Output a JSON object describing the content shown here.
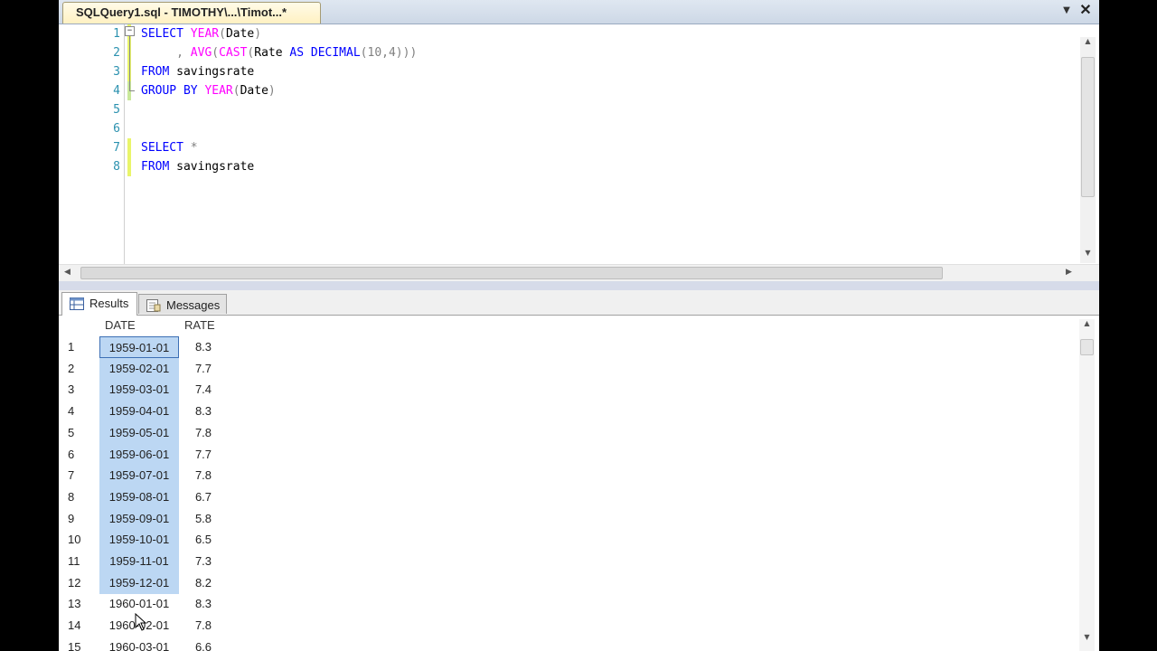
{
  "document_tab": {
    "title": "SQLQuery1.sql - TIMOTHY\\...\\Timot...*",
    "dropdown_icon": "chevron-down-icon",
    "close_icon": "close-icon"
  },
  "editor": {
    "line_numbers": [
      "1",
      "2",
      "3",
      "4",
      "5",
      "6",
      "7",
      "8"
    ],
    "lines": [
      {
        "segments": [
          {
            "t": "SELECT ",
            "c": "kw"
          },
          {
            "t": "YEAR",
            "c": "fn"
          },
          {
            "t": "(",
            "c": "op"
          },
          {
            "t": "Date",
            "c": "id"
          },
          {
            "t": ")",
            "c": "op"
          }
        ]
      },
      {
        "segments": [
          {
            "t": "     , ",
            "c": "op"
          },
          {
            "t": "AVG",
            "c": "fn"
          },
          {
            "t": "(",
            "c": "op"
          },
          {
            "t": "CAST",
            "c": "fn"
          },
          {
            "t": "(",
            "c": "op"
          },
          {
            "t": "Rate ",
            "c": "id"
          },
          {
            "t": "AS ",
            "c": "kw"
          },
          {
            "t": "DECIMAL",
            "c": "kw"
          },
          {
            "t": "(10,4)))",
            "c": "op"
          }
        ]
      },
      {
        "segments": [
          {
            "t": "FROM ",
            "c": "kw"
          },
          {
            "t": "savingsrate",
            "c": "id"
          }
        ]
      },
      {
        "segments": [
          {
            "t": "GROUP BY ",
            "c": "kw"
          },
          {
            "t": "YEAR",
            "c": "fn"
          },
          {
            "t": "(",
            "c": "op"
          },
          {
            "t": "Date",
            "c": "id"
          },
          {
            "t": ")",
            "c": "op"
          }
        ]
      },
      {
        "segments": []
      },
      {
        "segments": []
      },
      {
        "segments": [
          {
            "t": "SELECT ",
            "c": "kw"
          },
          {
            "t": "*",
            "c": "op"
          }
        ]
      },
      {
        "segments": [
          {
            "t": "FROM ",
            "c": "kw"
          },
          {
            "t": "savingsrate",
            "c": "id"
          }
        ]
      }
    ]
  },
  "result_tabs": {
    "results_label": "Results",
    "messages_label": "Messages"
  },
  "grid": {
    "columns": [
      "DATE",
      "RATE"
    ],
    "rows": [
      {
        "num": "1",
        "date": "1959-01-01",
        "rate": "8.3"
      },
      {
        "num": "2",
        "date": "1959-02-01",
        "rate": "7.7"
      },
      {
        "num": "3",
        "date": "1959-03-01",
        "rate": "7.4"
      },
      {
        "num": "4",
        "date": "1959-04-01",
        "rate": "8.3"
      },
      {
        "num": "5",
        "date": "1959-05-01",
        "rate": "7.8"
      },
      {
        "num": "6",
        "date": "1959-06-01",
        "rate": "7.7"
      },
      {
        "num": "7",
        "date": "1959-07-01",
        "rate": "7.8"
      },
      {
        "num": "8",
        "date": "1959-08-01",
        "rate": "6.7"
      },
      {
        "num": "9",
        "date": "1959-09-01",
        "rate": "5.8"
      },
      {
        "num": "10",
        "date": "1959-10-01",
        "rate": "6.5"
      },
      {
        "num": "11",
        "date": "1959-11-01",
        "rate": "7.3"
      },
      {
        "num": "12",
        "date": "1959-12-01",
        "rate": "8.2"
      },
      {
        "num": "13",
        "date": "1960-01-01",
        "rate": "8.3"
      },
      {
        "num": "14",
        "date": "1960-02-01",
        "rate": "7.8"
      },
      {
        "num": "15",
        "date": "1960-03-01",
        "rate": "6.6"
      }
    ],
    "selected_rows": 12
  },
  "colors": {
    "keyword": "#0000ff",
    "function": "#ff00ff",
    "operator": "#808080",
    "line_number": "#2b91af",
    "selection": "#bcd7f3",
    "changed_line_marker": "#e9f56a"
  }
}
